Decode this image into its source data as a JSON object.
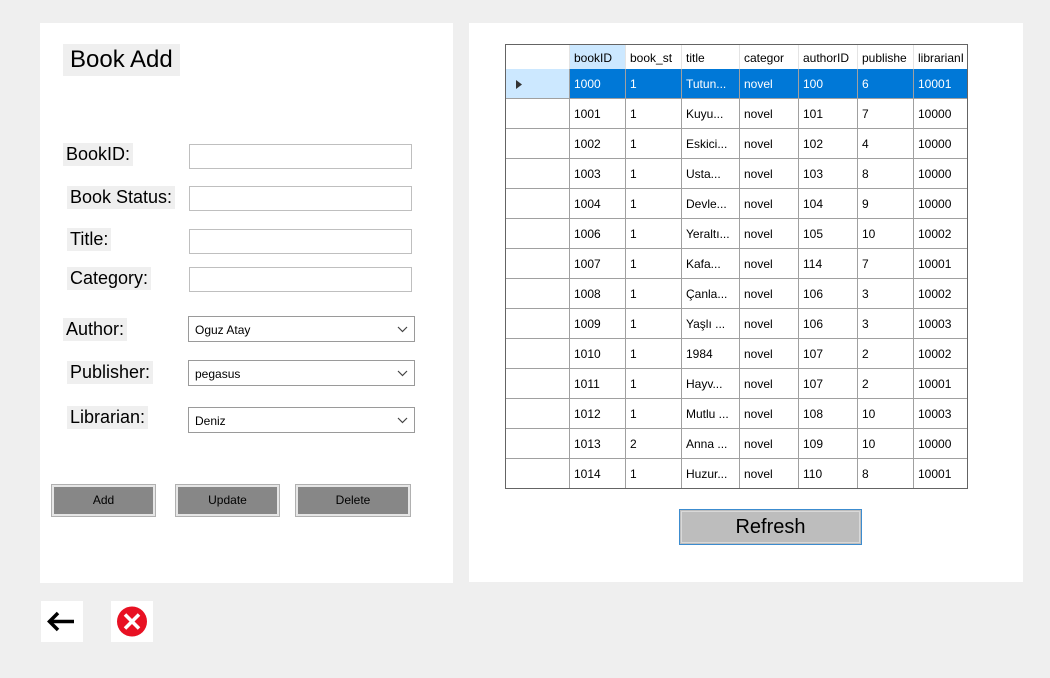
{
  "form": {
    "title": "Book Add",
    "labels": {
      "book_id": "BookID:",
      "book_status": "Book Status:",
      "title": "Title:",
      "category": "Category:",
      "author": "Author:",
      "publisher": "Publisher:",
      "librarian": "Librarian:"
    },
    "author_value": "Oguz Atay",
    "publisher_value": "pegasus",
    "librarian_value": "Deniz",
    "buttons": {
      "add": "Add",
      "update": "Update",
      "delete": "Delete"
    }
  },
  "grid": {
    "columns": [
      "bookID",
      "book_st",
      "title",
      "categor",
      "authorID",
      "publishe",
      "librarianI"
    ],
    "rows": [
      [
        "1000",
        "1",
        "Tutun...",
        "novel",
        "100",
        "6",
        "10001"
      ],
      [
        "1001",
        "1",
        "Kuyu...",
        "novel",
        "101",
        "7",
        "10000"
      ],
      [
        "1002",
        "1",
        "Eskici...",
        "novel",
        "102",
        "4",
        "10000"
      ],
      [
        "1003",
        "1",
        "Usta...",
        "novel",
        "103",
        "8",
        "10000"
      ],
      [
        "1004",
        "1",
        "Devle...",
        "novel",
        "104",
        "9",
        "10000"
      ],
      [
        "1006",
        "1",
        "Yeraltı...",
        "novel",
        "105",
        "10",
        "10002"
      ],
      [
        "1007",
        "1",
        "Kafa...",
        "novel",
        "114",
        "7",
        "10001"
      ],
      [
        "1008",
        "1",
        "Çanla...",
        "novel",
        "106",
        "3",
        "10002"
      ],
      [
        "1009",
        "1",
        "Yaşlı ...",
        "novel",
        "106",
        "3",
        "10003"
      ],
      [
        "1010",
        "1",
        "1984",
        "novel",
        "107",
        "2",
        "10002"
      ],
      [
        "1011",
        "1",
        "Hayv...",
        "novel",
        "107",
        "2",
        "10001"
      ],
      [
        "1012",
        "1",
        "Mutlu ...",
        "novel",
        "108",
        "10",
        "10003"
      ],
      [
        "1013",
        "2",
        "Anna ...",
        "novel",
        "109",
        "10",
        "10000"
      ],
      [
        "1014",
        "1",
        "Huzur...",
        "novel",
        "110",
        "8",
        "10001"
      ]
    ],
    "selected_row": 0
  },
  "refresh_label": "Refresh",
  "icons": {
    "back": "arrow-left-icon",
    "close": "close-icon"
  },
  "colors": {
    "selection": "#0078d7",
    "close_red": "#e81123",
    "button_gray": "#878787"
  }
}
